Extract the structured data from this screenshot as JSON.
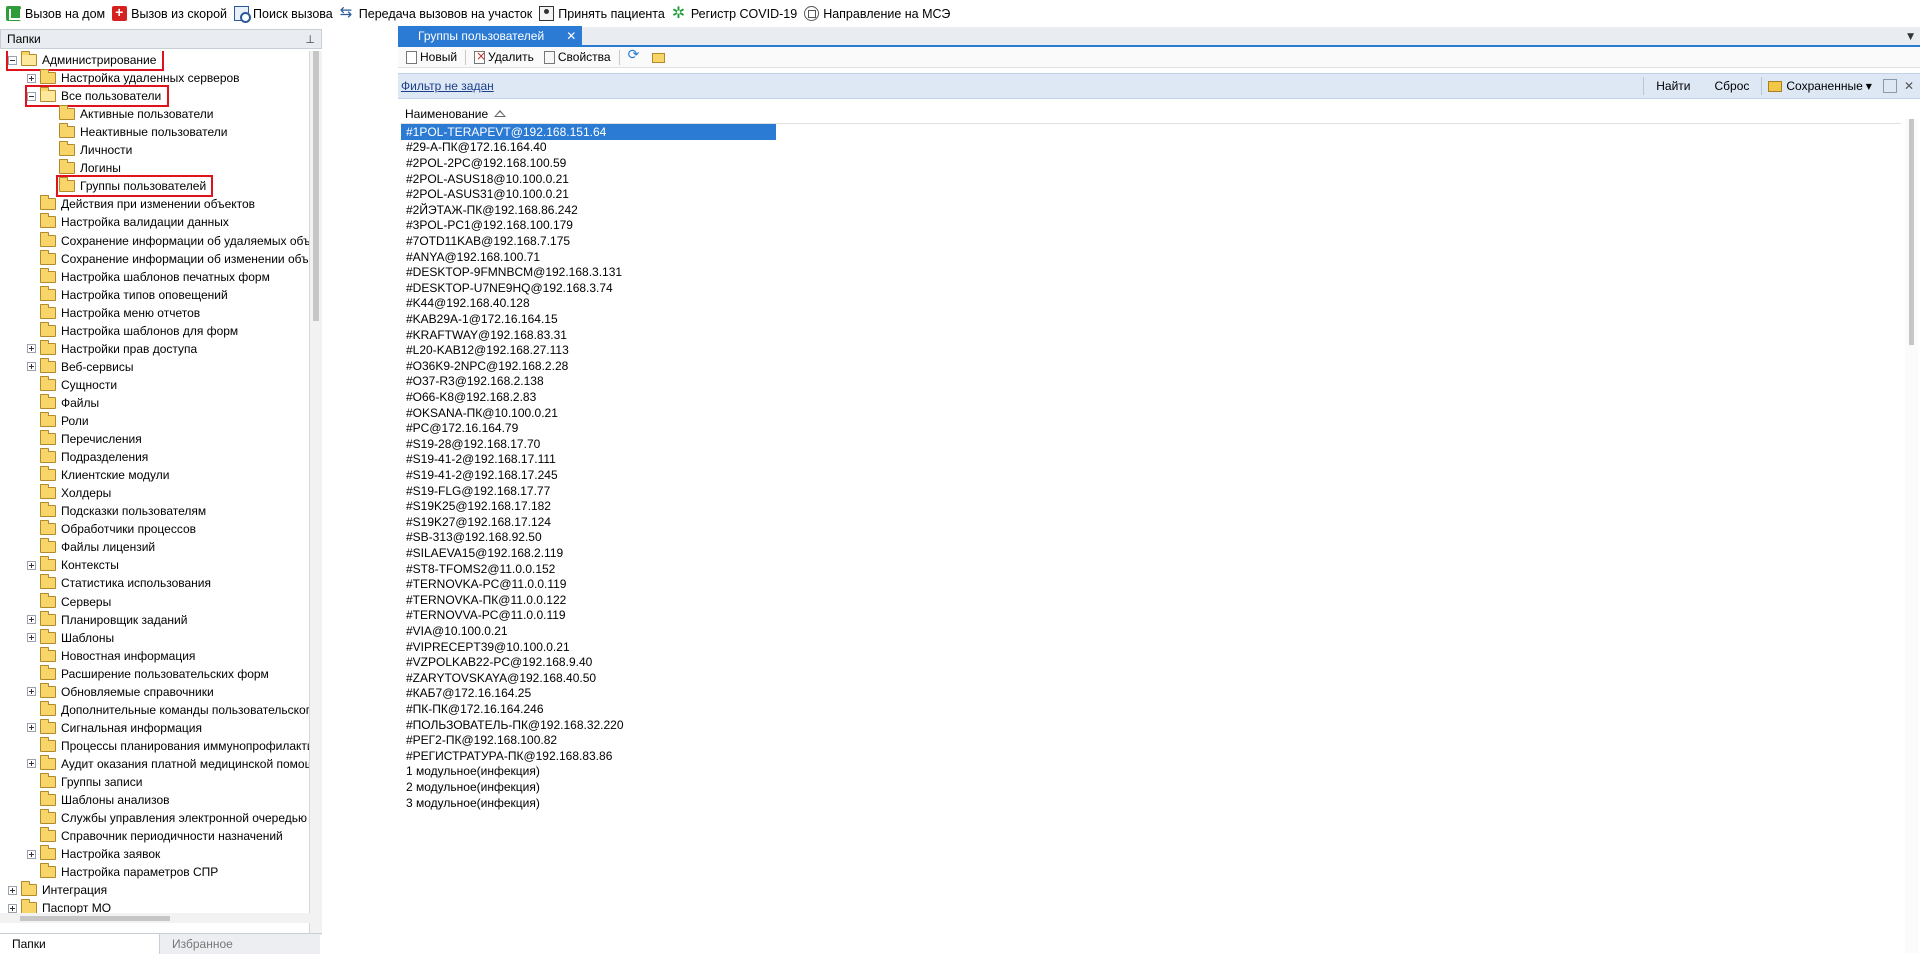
{
  "toolbar": {
    "items": [
      {
        "label": "Вызов на дом",
        "icon": "house-call-icon"
      },
      {
        "label": "Вызов из скорой",
        "icon": "ambulance-icon"
      },
      {
        "label": "Поиск вызова",
        "icon": "search-call-icon"
      },
      {
        "label": "Передача вызовов на участок",
        "icon": "transfer-icon"
      },
      {
        "label": "Принять пациента",
        "icon": "patient-icon"
      },
      {
        "label": "Регистр COVID-19",
        "icon": "covid-icon"
      },
      {
        "label": "Направление на МСЭ",
        "icon": "mse-icon"
      }
    ]
  },
  "left_panel": {
    "title": "Папки",
    "tabs": [
      "Папки",
      "Избранное"
    ],
    "active_tab": "Папки",
    "tree": [
      {
        "label": "Администрирование",
        "level": 0,
        "toggle": "minus",
        "highlight": true,
        "open": true
      },
      {
        "label": "Настройка удаленных серверов",
        "level": 1,
        "toggle": "plus"
      },
      {
        "label": "Все пользователи",
        "level": 1,
        "toggle": "minus",
        "highlight": true,
        "open": true
      },
      {
        "label": "Активные пользователи",
        "level": 2,
        "toggle": "none"
      },
      {
        "label": "Неактивные пользователи",
        "level": 2,
        "toggle": "none"
      },
      {
        "label": "Личности",
        "level": 2,
        "toggle": "none"
      },
      {
        "label": "Логины",
        "level": 2,
        "toggle": "none"
      },
      {
        "label": "Группы пользователей",
        "level": 2,
        "toggle": "none",
        "highlight": true,
        "selected": true
      },
      {
        "label": "Действия при изменении объектов",
        "level": 1,
        "toggle": "none"
      },
      {
        "label": "Настройка валидации данных",
        "level": 1,
        "toggle": "none"
      },
      {
        "label": "Сохранение информации об удаляемых объектах",
        "level": 1,
        "toggle": "none"
      },
      {
        "label": "Сохранение информации об изменении объектов",
        "level": 1,
        "toggle": "none"
      },
      {
        "label": "Настройка шаблонов печатных форм",
        "level": 1,
        "toggle": "none"
      },
      {
        "label": "Настройка типов оповещений",
        "level": 1,
        "toggle": "none"
      },
      {
        "label": "Настройка меню отчетов",
        "level": 1,
        "toggle": "none"
      },
      {
        "label": "Настройка шаблонов для форм",
        "level": 1,
        "toggle": "none"
      },
      {
        "label": "Настройки прав доступа",
        "level": 1,
        "toggle": "plus"
      },
      {
        "label": "Веб-сервисы",
        "level": 1,
        "toggle": "plus"
      },
      {
        "label": "Сущности",
        "level": 1,
        "toggle": "none"
      },
      {
        "label": "Файлы",
        "level": 1,
        "toggle": "none"
      },
      {
        "label": "Роли",
        "level": 1,
        "toggle": "none"
      },
      {
        "label": "Перечисления",
        "level": 1,
        "toggle": "none"
      },
      {
        "label": "Подразделения",
        "level": 1,
        "toggle": "none"
      },
      {
        "label": "Клиентские модули",
        "level": 1,
        "toggle": "none"
      },
      {
        "label": "Холдеры",
        "level": 1,
        "toggle": "none"
      },
      {
        "label": "Подсказки пользователям",
        "level": 1,
        "toggle": "none"
      },
      {
        "label": "Обработчики процессов",
        "level": 1,
        "toggle": "none"
      },
      {
        "label": "Файлы лицензий",
        "level": 1,
        "toggle": "none"
      },
      {
        "label": "Контексты",
        "level": 1,
        "toggle": "plus"
      },
      {
        "label": "Статистика использования",
        "level": 1,
        "toggle": "none"
      },
      {
        "label": "Серверы",
        "level": 1,
        "toggle": "none"
      },
      {
        "label": "Планировщик заданий",
        "level": 1,
        "toggle": "plus"
      },
      {
        "label": "Шаблоны",
        "level": 1,
        "toggle": "plus"
      },
      {
        "label": "Новостная информация",
        "level": 1,
        "toggle": "none"
      },
      {
        "label": "Расширение пользовательских форм",
        "level": 1,
        "toggle": "none"
      },
      {
        "label": "Обновляемые справочники",
        "level": 1,
        "toggle": "plus"
      },
      {
        "label": "Дополнительные команды пользовательского интерфейса",
        "level": 1,
        "toggle": "none"
      },
      {
        "label": "Сигнальная информация",
        "level": 1,
        "toggle": "plus"
      },
      {
        "label": "Процессы планирования иммунопрофилактики",
        "level": 1,
        "toggle": "none"
      },
      {
        "label": "Аудит оказания платной медицинской помощи",
        "level": 1,
        "toggle": "plus"
      },
      {
        "label": "Группы записи",
        "level": 1,
        "toggle": "none"
      },
      {
        "label": "Шаблоны анализов",
        "level": 1,
        "toggle": "none"
      },
      {
        "label": "Службы управления электронной очередью",
        "level": 1,
        "toggle": "none"
      },
      {
        "label": "Справочник периодичности назначений",
        "level": 1,
        "toggle": "none"
      },
      {
        "label": "Настройка заявок",
        "level": 1,
        "toggle": "plus"
      },
      {
        "label": "Настройка параметров СПР",
        "level": 1,
        "toggle": "none"
      },
      {
        "label": "Интеграция",
        "level": 0,
        "toggle": "plus"
      },
      {
        "label": "Паспорт МО",
        "level": 0,
        "toggle": "plus"
      }
    ]
  },
  "document": {
    "tab_title": "Группы пользователей",
    "toolbar": {
      "new": "Новый",
      "delete": "Удалить",
      "properties": "Свойства"
    },
    "filter": {
      "link": "Фильтр не задан",
      "find": "Найти",
      "reset": "Сброс",
      "saved": "Сохраненные"
    },
    "grid": {
      "column": "Наименование",
      "rows": [
        "#1POL-TERAPEVT@192.168.151.64",
        "#29-А-ПК@172.16.164.40",
        "#2POL-2PC@192.168.100.59",
        "#2POL-ASUS18@10.100.0.21",
        "#2POL-ASUS31@10.100.0.21",
        "#2ЙЭТАЖ-ПК@192.168.86.242",
        "#3POL-PC1@192.168.100.179",
        "#7OTD11KAB@192.168.7.175",
        "#ANYA@192.168.100.71",
        "#DESKTOP-9FMNBCM@192.168.3.131",
        "#DESKTOP-U7NE9HQ@192.168.3.74",
        "#K44@192.168.40.128",
        "#KAB29A-1@172.16.164.15",
        "#KRAFTWAY@192.168.83.31",
        "#L20-KAB12@192.168.27.113",
        "#O36K9-2NPC@192.168.2.28",
        "#O37-R3@192.168.2.138",
        "#O66-K8@192.168.2.83",
        "#OKSANA-ПК@10.100.0.21",
        "#PC@172.16.164.79",
        "#S19-28@192.168.17.70",
        "#S19-41-2@192.168.17.111",
        "#S19-41-2@192.168.17.245",
        "#S19-FLG@192.168.17.77",
        "#S19K25@192.168.17.182",
        "#S19K27@192.168.17.124",
        "#SB-313@192.168.92.50",
        "#SILAEVA15@192.168.2.119",
        "#ST8-TFOMS2@11.0.0.152",
        "#TERNOVKA-PC@11.0.0.119",
        "#TERNOVKA-ПК@11.0.0.122",
        "#TERNOVVA-PC@11.0.0.119",
        "#VIA@10.100.0.21",
        "#VIPRECEPT39@10.100.0.21",
        "#VZPOLKAB22-PC@192.168.9.40",
        "#ZARYTOVSKAYA@192.168.40.50",
        "#КАБ7@172.16.164.25",
        "#ПК-ПК@172.16.164.246",
        "#ПОЛЬЗОВАТЕЛЬ-ПК@192.168.32.220",
        "#РЕГ2-ПК@192.168.100.82",
        "#РЕГИСТРАТУРА-ПК@192.168.83.86",
        "1 модульное(инфекция)",
        "2 модульное(инфекция)",
        "3 модульное(инфекция)"
      ]
    }
  },
  "colors": {
    "accent": "#2b7ad3",
    "highlight_border": "#e0131d",
    "filter_bar": "#dde8f4"
  }
}
